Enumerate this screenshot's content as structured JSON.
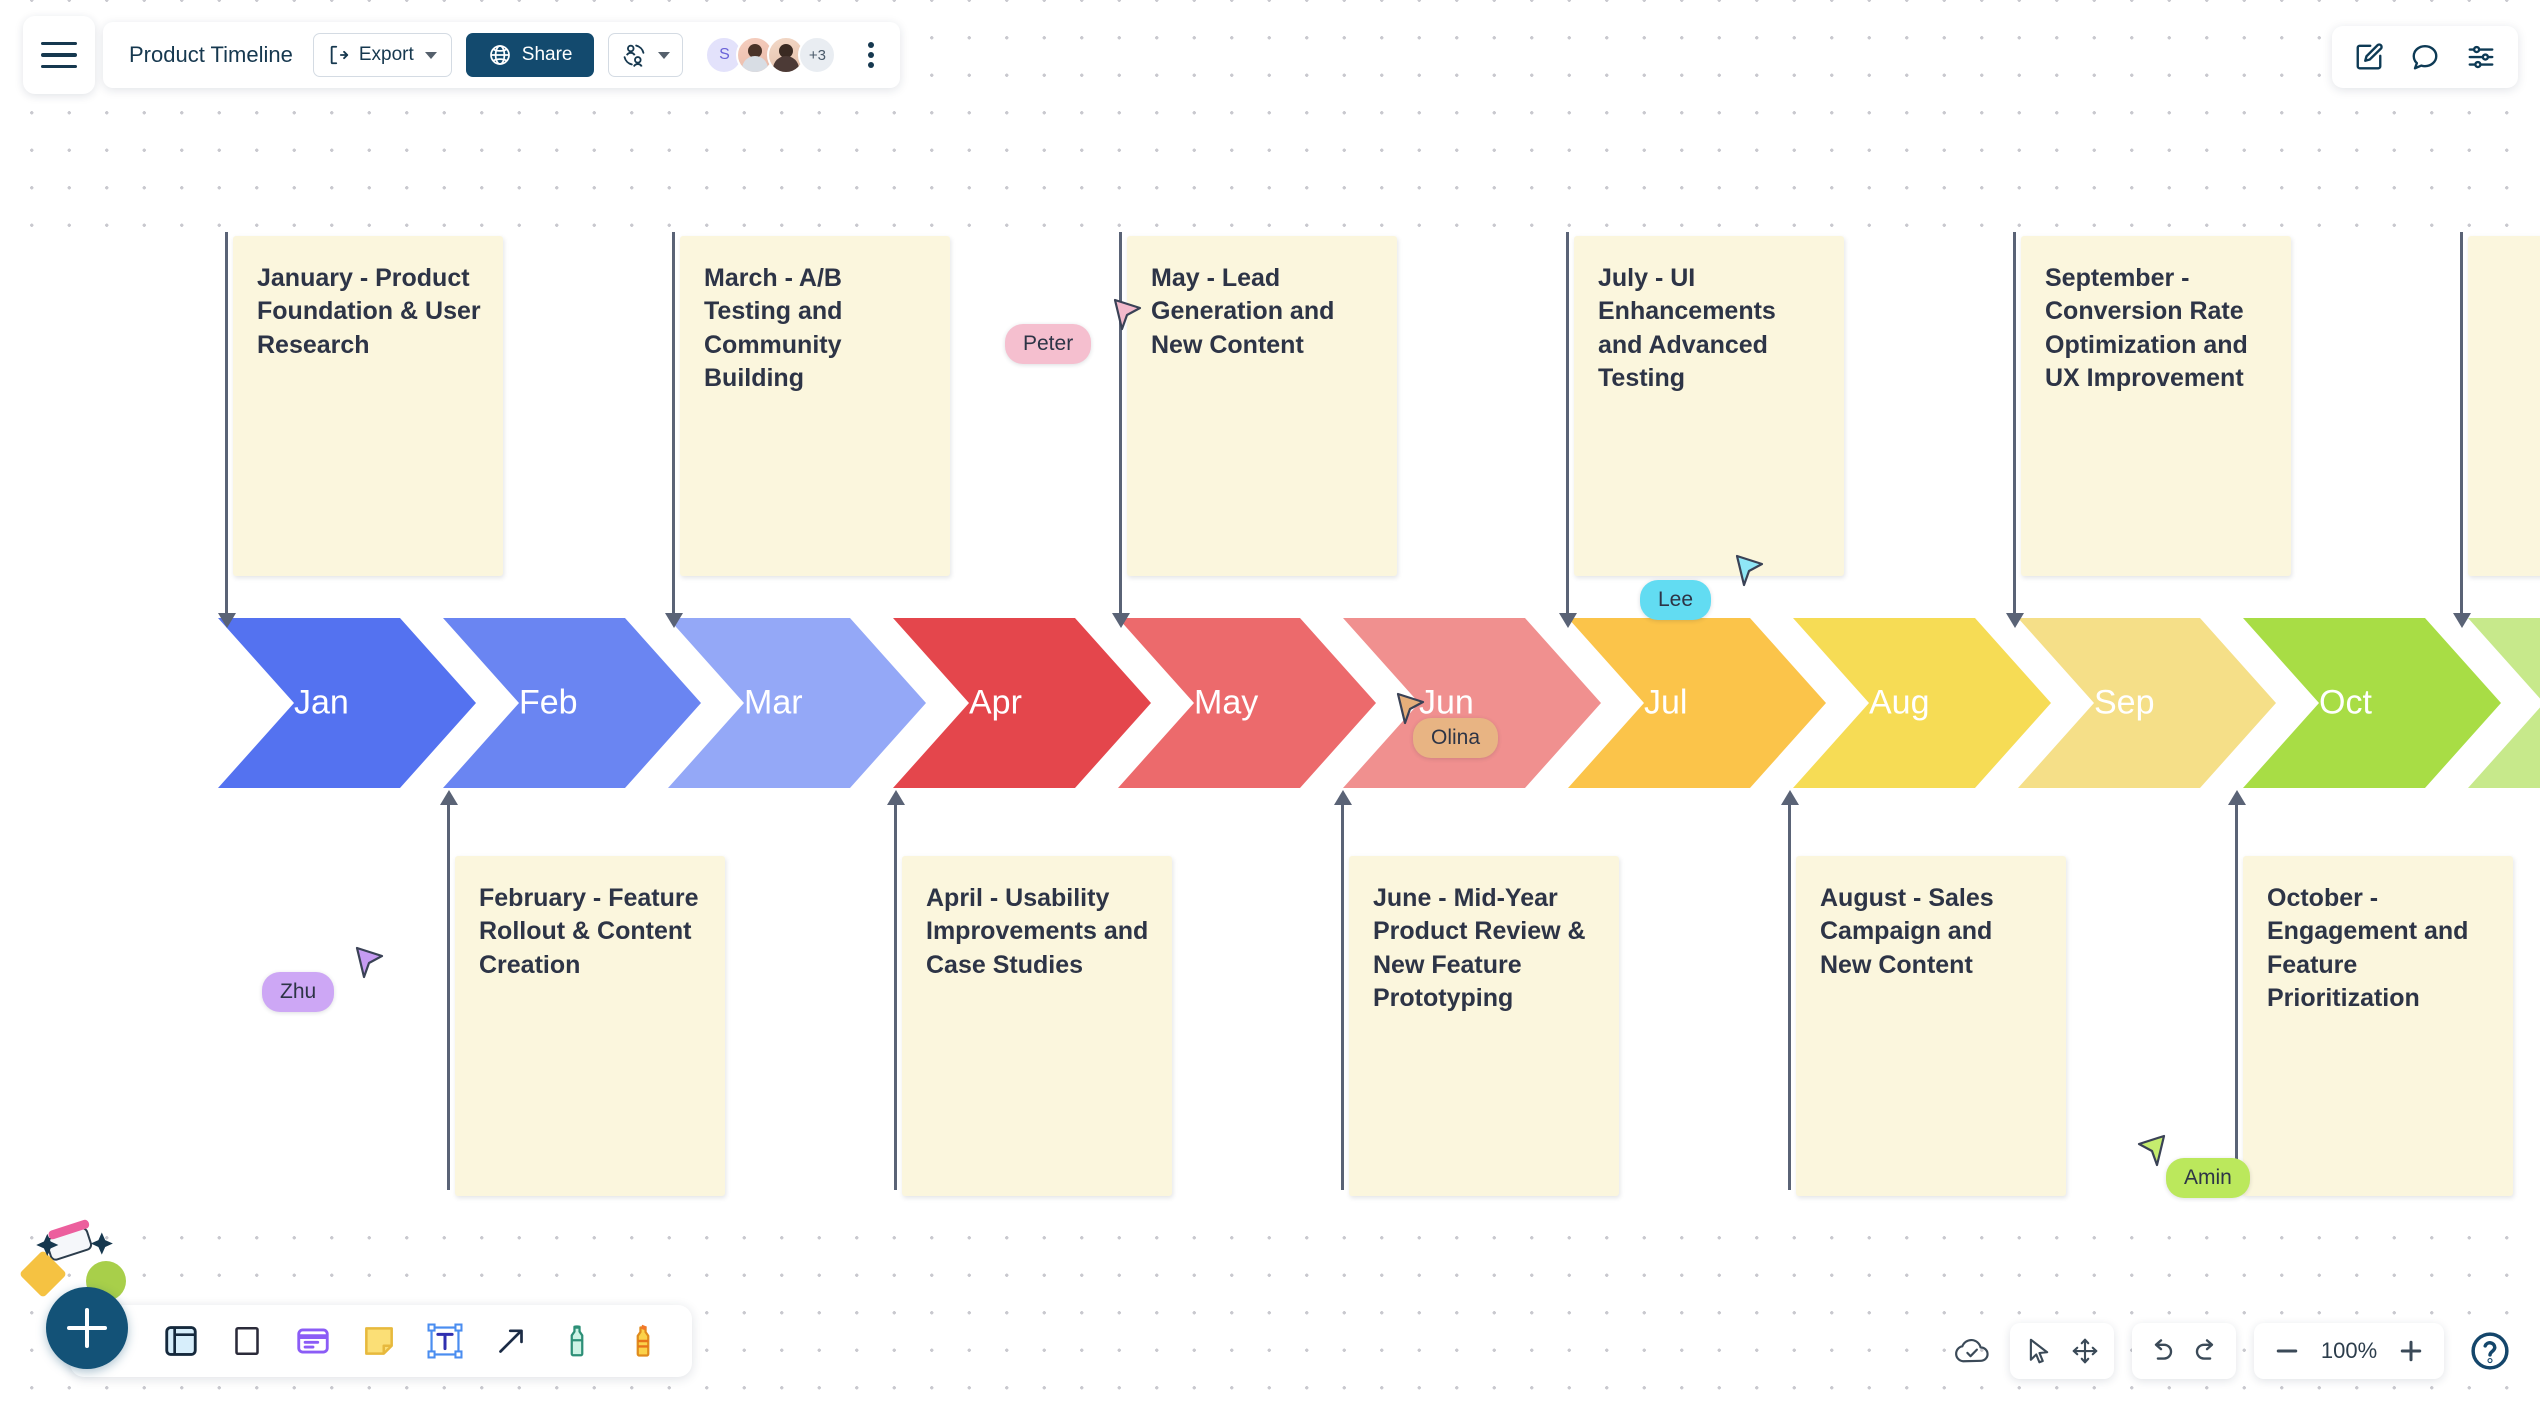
{
  "header": {
    "menu_icon": "hamburger-menu-icon",
    "title": "Product Timeline",
    "export_label": "Export",
    "export_icon": "export-icon",
    "share_label": "Share",
    "share_icon": "globe-icon",
    "collab_icon": "collaborators-icon",
    "more_icon": "kebab-menu-icon",
    "avatars": [
      {
        "type": "initial",
        "label": "S"
      },
      {
        "type": "photo",
        "label": ""
      },
      {
        "type": "photo",
        "label": ""
      },
      {
        "type": "count",
        "label": "+3"
      }
    ]
  },
  "top_right": {
    "edit_icon": "edit-square-pencil-icon",
    "comment_icon": "comment-bubble-icon",
    "settings_icon": "sliders-settings-icon"
  },
  "timeline": {
    "months": [
      {
        "label": "Jan",
        "color": "#5472f0"
      },
      {
        "label": "Feb",
        "color": "#6a85f2"
      },
      {
        "label": "Mar",
        "color": "#94a8f7"
      },
      {
        "label": "Apr",
        "color": "#e4464c"
      },
      {
        "label": "May",
        "color": "#ec6a6c"
      },
      {
        "label": "Jun",
        "color": "#f0908f"
      },
      {
        "label": "Jul",
        "color": "#fbc44a"
      },
      {
        "label": "Aug",
        "color": "#f6dc55"
      },
      {
        "label": "Sep",
        "color": "#f5df88"
      },
      {
        "label": "Oct",
        "color": "#a8dd45"
      },
      {
        "label": "",
        "color": "#c7e98b"
      }
    ]
  },
  "notes": [
    {
      "id": "jan",
      "text": "January - Product Foundation & User Research",
      "position": "above"
    },
    {
      "id": "feb",
      "text": "February - Feature Rollout & Content Creation",
      "position": "below"
    },
    {
      "id": "mar",
      "text": "March - A/B Testing and Community Building",
      "position": "above"
    },
    {
      "id": "apr",
      "text": "April - Usability Improvements and Case Studies",
      "position": "below"
    },
    {
      "id": "may",
      "text": "May - Lead Generation and New Content",
      "position": "above"
    },
    {
      "id": "jun",
      "text": "June - Mid-Year Product Review & New Feature Prototyping",
      "position": "below"
    },
    {
      "id": "jul",
      "text": "July - UI Enhancements and Advanced Testing",
      "position": "above"
    },
    {
      "id": "aug",
      "text": "August - Sales Campaign and New Content",
      "position": "below"
    },
    {
      "id": "sep",
      "text": "September - Conversion Rate Optimization and UX Improvement",
      "position": "above"
    },
    {
      "id": "oct",
      "text": "October - Engagement and Feature Prioritization",
      "position": "below"
    },
    {
      "id": "nov",
      "text": "",
      "position": "above"
    }
  ],
  "cursors": [
    {
      "name": "Peter",
      "color": "#f5bfcf",
      "cursor_color": "#f3b9cb"
    },
    {
      "name": "Zhu",
      "color": "#cda7f5",
      "cursor_color": "#c69bf2"
    },
    {
      "name": "Olina",
      "color": "#e8b483",
      "cursor_color": "#e5ae7a"
    },
    {
      "name": "Lee",
      "color": "#62dcf2",
      "cursor_color": "#8fe6f6"
    },
    {
      "name": "Amin",
      "color": "#bbe85c",
      "cursor_color": "#c5ec6e"
    }
  ],
  "bottom_toolbar": {
    "add_icon": "add-plus-button",
    "tools": [
      {
        "icon": "template-frame-icon",
        "label": "Template"
      },
      {
        "icon": "rectangle-shape-icon",
        "label": "Shape"
      },
      {
        "icon": "card-icon",
        "label": "Card"
      },
      {
        "icon": "sticky-note-icon",
        "label": "Sticky Note"
      },
      {
        "icon": "text-tool-icon",
        "label": "Text"
      },
      {
        "icon": "arrow-connector-icon",
        "label": "Connector"
      },
      {
        "icon": "pen-marker-icon",
        "label": "Pen"
      },
      {
        "icon": "highlighter-icon",
        "label": "Highlighter"
      }
    ]
  },
  "bottom_right": {
    "save_status_icon": "cloud-check-saved-icon",
    "select_icon": "cursor-select-icon",
    "pan_icon": "pan-move-icon",
    "undo_icon": "undo-icon",
    "redo_icon": "redo-icon",
    "zoom_out_icon": "zoom-out-minus-icon",
    "zoom_level": "100%",
    "zoom_in_icon": "zoom-in-plus-icon",
    "help_icon": "help-question-icon"
  }
}
